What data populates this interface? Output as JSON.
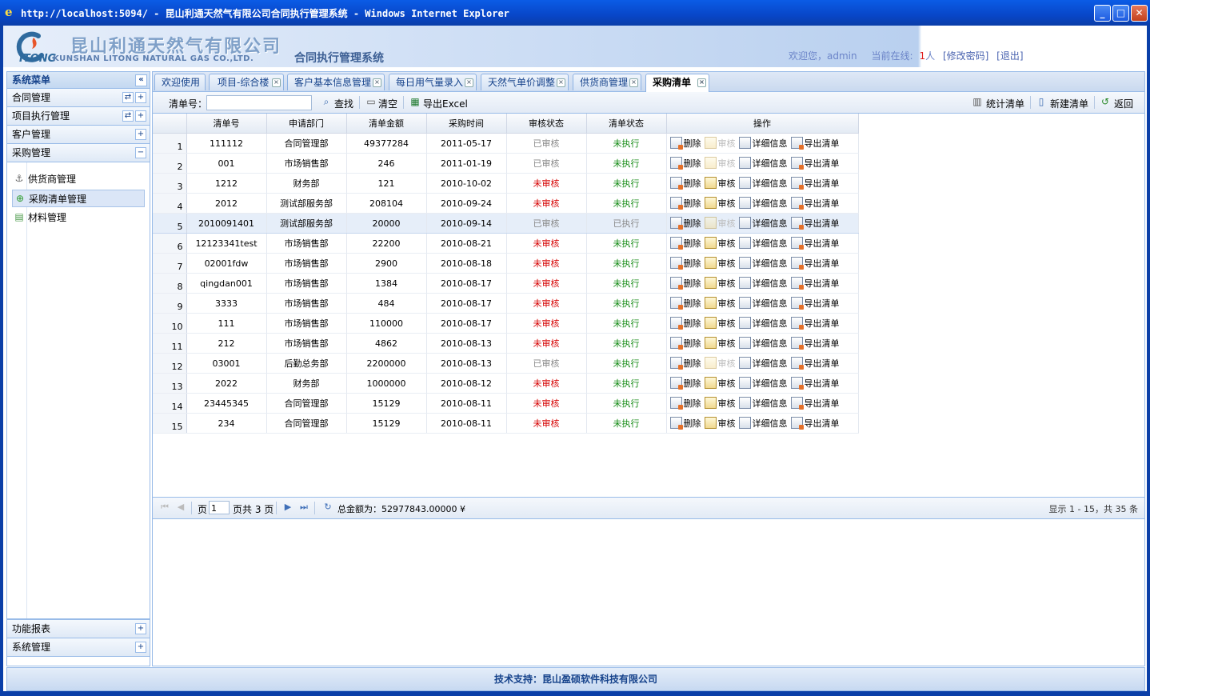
{
  "window": {
    "title": "http://localhost:5094/ - 昆山利通天然气有限公司合同执行管理系统 - Windows Internet Explorer"
  },
  "header": {
    "company_cn": "昆山利通天然气有限公司",
    "company_en": "KUNSHAN LITONG NATURAL GAS CO.,LTD.",
    "logo_mark": "ITONG",
    "system_name": "合同执行管理系统",
    "welcome": "欢迎您，admin",
    "online_label": "当前在线:",
    "online_count": "1",
    "online_unit": "人",
    "change_password": "[修改密码]",
    "logout": "[退出]"
  },
  "sidebar": {
    "title": "系统菜单",
    "sections": [
      {
        "label": "合同管理"
      },
      {
        "label": "项目执行管理"
      },
      {
        "label": "客户管理"
      },
      {
        "label": "采购管理"
      }
    ],
    "items": [
      {
        "label": "供货商管理",
        "icon": "anchor-icon"
      },
      {
        "label": "采购清单管理",
        "icon": "add-circle-icon"
      },
      {
        "label": "材料管理",
        "icon": "database-icon"
      }
    ],
    "bottom_sections": [
      {
        "label": "功能报表"
      },
      {
        "label": "系统管理"
      }
    ]
  },
  "tabs": [
    {
      "label": "欢迎使用"
    },
    {
      "label": "项目-综合楼"
    },
    {
      "label": "客户基本信息管理"
    },
    {
      "label": "每日用气量录入"
    },
    {
      "label": "天然气单价调整"
    },
    {
      "label": "供货商管理"
    },
    {
      "label": "采购清单"
    }
  ],
  "toolbar": {
    "order_label": "清单号：",
    "order_value": "",
    "search": "查找",
    "clear": "清空",
    "export_excel": "导出Excel",
    "stats": "统计清单",
    "new": "新建清单",
    "back": "返回"
  },
  "grid": {
    "columns": [
      "清单号",
      "申请部门",
      "清单金额",
      "采购时间",
      "审核状态",
      "清单状态",
      "操作"
    ],
    "op_labels": {
      "delete": "删除",
      "audit": "审核",
      "detail": "详细信息",
      "export": "导出清单"
    },
    "rows": [
      {
        "no": "1",
        "id": "111112",
        "dept": "合同管理部",
        "amount": "49377284",
        "date": "2011-05-17",
        "audit": "已审核",
        "status": "未执行"
      },
      {
        "no": "2",
        "id": "001",
        "dept": "市场销售部",
        "amount": "246",
        "date": "2011-01-19",
        "audit": "已审核",
        "status": "未执行"
      },
      {
        "no": "3",
        "id": "1212",
        "dept": "财务部",
        "amount": "121",
        "date": "2010-10-02",
        "audit": "未审核",
        "status": "未执行"
      },
      {
        "no": "4",
        "id": "2012",
        "dept": "测试部服务部",
        "amount": "208104",
        "date": "2010-09-24",
        "audit": "未审核",
        "status": "未执行"
      },
      {
        "no": "5",
        "id": "2010091401",
        "dept": "测试部服务部",
        "amount": "20000",
        "date": "2010-09-14",
        "audit": "已审核",
        "status": "已执行"
      },
      {
        "no": "6",
        "id": "12123341test",
        "dept": "市场销售部",
        "amount": "22200",
        "date": "2010-08-21",
        "audit": "未审核",
        "status": "未执行"
      },
      {
        "no": "7",
        "id": "02001fdw",
        "dept": "市场销售部",
        "amount": "2900",
        "date": "2010-08-18",
        "audit": "未审核",
        "status": "未执行"
      },
      {
        "no": "8",
        "id": "qingdan001",
        "dept": "市场销售部",
        "amount": "1384",
        "date": "2010-08-17",
        "audit": "未审核",
        "status": "未执行"
      },
      {
        "no": "9",
        "id": "3333",
        "dept": "市场销售部",
        "amount": "484",
        "date": "2010-08-17",
        "audit": "未审核",
        "status": "未执行"
      },
      {
        "no": "10",
        "id": "111",
        "dept": "市场销售部",
        "amount": "110000",
        "date": "2010-08-17",
        "audit": "未审核",
        "status": "未执行"
      },
      {
        "no": "11",
        "id": "212",
        "dept": "市场销售部",
        "amount": "4862",
        "date": "2010-08-13",
        "audit": "未审核",
        "status": "未执行"
      },
      {
        "no": "12",
        "id": "03001",
        "dept": "后勤总务部",
        "amount": "2200000",
        "date": "2010-08-13",
        "audit": "已审核",
        "status": "未执行"
      },
      {
        "no": "13",
        "id": "2022",
        "dept": "财务部",
        "amount": "1000000",
        "date": "2010-08-12",
        "audit": "未审核",
        "status": "未执行"
      },
      {
        "no": "14",
        "id": "23445345",
        "dept": "合同管理部",
        "amount": "15129",
        "date": "2010-08-11",
        "audit": "未审核",
        "status": "未执行"
      },
      {
        "no": "15",
        "id": "234",
        "dept": "合同管理部",
        "amount": "15129",
        "date": "2010-08-11",
        "audit": "未审核",
        "status": "未执行"
      }
    ]
  },
  "pager": {
    "page_label": "页",
    "page_value": "1",
    "page_total": "页共 3 页",
    "total_amount": "总金额为：52977843.00000 ¥",
    "display_info": "显示 1 - 15，共 35 条"
  },
  "footer": {
    "text": "技术支持：昆山盈硕软件科技有限公司"
  },
  "colors": {
    "audited": "#888888",
    "unaudited": "#d60000",
    "status": "#138a13",
    "accent": "#15428b"
  }
}
